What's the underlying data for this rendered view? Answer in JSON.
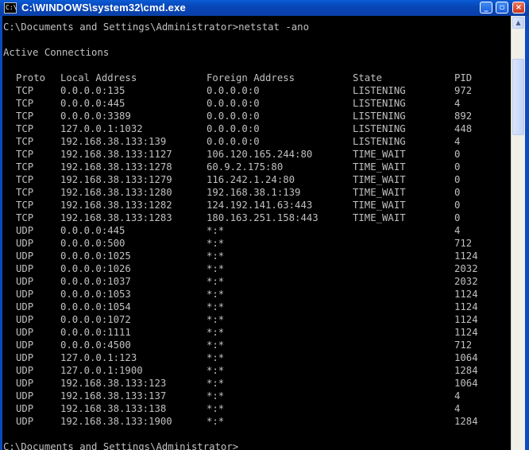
{
  "window": {
    "title": "C:\\WINDOWS\\system32\\cmd.exe",
    "icon_text": "C:\\",
    "minimize_glyph": "_",
    "maximize_glyph": "▫",
    "close_glyph": "×",
    "icons": [
      "console-icon",
      "minimize-icon",
      "restore-icon",
      "close-icon"
    ]
  },
  "console": {
    "command_line": "C:\\Documents and Settings\\Administrator>netstat -ano",
    "heading": "Active Connections",
    "headers": {
      "proto": "Proto",
      "local": "Local Address",
      "foreign": "Foreign Address",
      "state": "State",
      "pid": "PID"
    },
    "rows": [
      {
        "proto": "TCP",
        "local": "0.0.0.0:135",
        "foreign": "0.0.0.0:0",
        "state": "LISTENING",
        "pid": "972"
      },
      {
        "proto": "TCP",
        "local": "0.0.0.0:445",
        "foreign": "0.0.0.0:0",
        "state": "LISTENING",
        "pid": "4"
      },
      {
        "proto": "TCP",
        "local": "0.0.0.0:3389",
        "foreign": "0.0.0.0:0",
        "state": "LISTENING",
        "pid": "892"
      },
      {
        "proto": "TCP",
        "local": "127.0.0.1:1032",
        "foreign": "0.0.0.0:0",
        "state": "LISTENING",
        "pid": "448"
      },
      {
        "proto": "TCP",
        "local": "192.168.38.133:139",
        "foreign": "0.0.0.0:0",
        "state": "LISTENING",
        "pid": "4"
      },
      {
        "proto": "TCP",
        "local": "192.168.38.133:1127",
        "foreign": "106.120.165.244:80",
        "state": "TIME_WAIT",
        "pid": "0"
      },
      {
        "proto": "TCP",
        "local": "192.168.38.133:1278",
        "foreign": "60.9.2.175:80",
        "state": "TIME_WAIT",
        "pid": "0"
      },
      {
        "proto": "TCP",
        "local": "192.168.38.133:1279",
        "foreign": "116.242.1.24:80",
        "state": "TIME_WAIT",
        "pid": "0"
      },
      {
        "proto": "TCP",
        "local": "192.168.38.133:1280",
        "foreign": "192.168.38.1:139",
        "state": "TIME_WAIT",
        "pid": "0"
      },
      {
        "proto": "TCP",
        "local": "192.168.38.133:1282",
        "foreign": "124.192.141.63:443",
        "state": "TIME_WAIT",
        "pid": "0"
      },
      {
        "proto": "TCP",
        "local": "192.168.38.133:1283",
        "foreign": "180.163.251.158:443",
        "state": "TIME_WAIT",
        "pid": "0"
      },
      {
        "proto": "UDP",
        "local": "0.0.0.0:445",
        "foreign": "*:*",
        "state": "",
        "pid": "4"
      },
      {
        "proto": "UDP",
        "local": "0.0.0.0:500",
        "foreign": "*:*",
        "state": "",
        "pid": "712"
      },
      {
        "proto": "UDP",
        "local": "0.0.0.0:1025",
        "foreign": "*:*",
        "state": "",
        "pid": "1124"
      },
      {
        "proto": "UDP",
        "local": "0.0.0.0:1026",
        "foreign": "*:*",
        "state": "",
        "pid": "2032"
      },
      {
        "proto": "UDP",
        "local": "0.0.0.0:1037",
        "foreign": "*:*",
        "state": "",
        "pid": "2032"
      },
      {
        "proto": "UDP",
        "local": "0.0.0.0:1053",
        "foreign": "*:*",
        "state": "",
        "pid": "1124"
      },
      {
        "proto": "UDP",
        "local": "0.0.0.0:1054",
        "foreign": "*:*",
        "state": "",
        "pid": "1124"
      },
      {
        "proto": "UDP",
        "local": "0.0.0.0:1072",
        "foreign": "*:*",
        "state": "",
        "pid": "1124"
      },
      {
        "proto": "UDP",
        "local": "0.0.0.0:1111",
        "foreign": "*:*",
        "state": "",
        "pid": "1124"
      },
      {
        "proto": "UDP",
        "local": "0.0.0.0:4500",
        "foreign": "*:*",
        "state": "",
        "pid": "712"
      },
      {
        "proto": "UDP",
        "local": "127.0.0.1:123",
        "foreign": "*:*",
        "state": "",
        "pid": "1064"
      },
      {
        "proto": "UDP",
        "local": "127.0.0.1:1900",
        "foreign": "*:*",
        "state": "",
        "pid": "1284"
      },
      {
        "proto": "UDP",
        "local": "192.168.38.133:123",
        "foreign": "*:*",
        "state": "",
        "pid": "1064"
      },
      {
        "proto": "UDP",
        "local": "192.168.38.133:137",
        "foreign": "*:*",
        "state": "",
        "pid": "4"
      },
      {
        "proto": "UDP",
        "local": "192.168.38.133:138",
        "foreign": "*:*",
        "state": "",
        "pid": "4"
      },
      {
        "proto": "UDP",
        "local": "192.168.38.133:1900",
        "foreign": "*:*",
        "state": "",
        "pid": "1284"
      }
    ],
    "prompt": "C:\\Documents and Settings\\Administrator>"
  },
  "colors": {
    "title_bar": "#0a4fc4",
    "console_bg": "#000000",
    "console_text": "#c0c0c0",
    "close_button": "#d6472a"
  },
  "scrollbar": {
    "up_glyph": "▲",
    "down_glyph": "▼",
    "position_fraction": 0.05
  }
}
